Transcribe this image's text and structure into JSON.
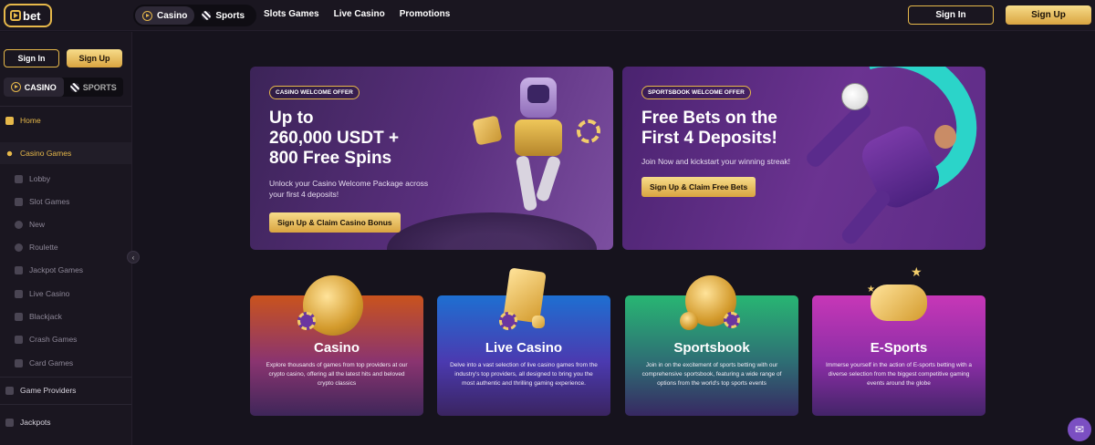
{
  "header": {
    "logo_text": "bet",
    "mode_tabs": [
      {
        "label": "Casino",
        "active": true
      },
      {
        "label": "Sports",
        "active": false
      }
    ],
    "nav": [
      "Slots Games",
      "Live Casino",
      "Promotions"
    ],
    "sign_in_label": "Sign In",
    "sign_up_label": "Sign Up"
  },
  "sidebar": {
    "sign_in_label": "Sign In",
    "sign_up_label": "Sign Up",
    "mode_tabs": [
      {
        "label": "CASINO",
        "active": true
      },
      {
        "label": "SPORTS",
        "active": false
      }
    ],
    "items": [
      {
        "label": "Home",
        "icon": "home-icon"
      },
      {
        "label": "Casino Games",
        "icon": "casino-games-icon"
      },
      {
        "label": "Lobby",
        "icon": "lobby-icon"
      },
      {
        "label": "Slot Games",
        "icon": "slot-icon"
      },
      {
        "label": "New",
        "icon": "new-icon"
      },
      {
        "label": "Roulette",
        "icon": "roulette-icon"
      },
      {
        "label": "Jackpot Games",
        "icon": "jackpot-icon"
      },
      {
        "label": "Live Casino",
        "icon": "crown-icon"
      },
      {
        "label": "Blackjack",
        "icon": "blackjack-icon"
      },
      {
        "label": "Crash Games",
        "icon": "plane-icon"
      },
      {
        "label": "Card Games",
        "icon": "cards-icon"
      },
      {
        "label": "Game Providers",
        "icon": "providers-icon"
      },
      {
        "label": "Jackpots",
        "icon": "jackpots-icon"
      }
    ]
  },
  "banners": [
    {
      "tag": "CASINO WELCOME OFFER",
      "headline_lines": [
        "Up to",
        "260,000 USDT +",
        "800 Free Spins"
      ],
      "subtext_lines": [
        "Unlock your Casino Welcome Package across",
        "your first 4 deposits!"
      ],
      "cta": "Sign Up & Claim Casino Bonus"
    },
    {
      "tag": "SPORTSBOOK WELCOME OFFER",
      "headline_lines": [
        "Free Bets on the",
        "First 4 Deposits!"
      ],
      "subtext_lines": [
        "Join Now and kickstart your winning streak!"
      ],
      "cta": "Sign Up & Claim Free Bets"
    }
  ],
  "categories": [
    {
      "title": "Casino",
      "desc": "Explore thousands of games from top providers at our crypto casino, offering all the latest hits and beloved crypto classics"
    },
    {
      "title": "Live Casino",
      "desc": "Delve into a vast selection of live casino games from the industry's top providers, all designed to bring you the most authentic and thrilling gaming experience."
    },
    {
      "title": "Sportsbook",
      "desc": "Join in on the excitement of sports betting with our comprehensive sportsbook, featuring a wide range of options from the world's top sports events"
    },
    {
      "title": "E-Sports",
      "desc": "Immerse yourself in the action of E-sports betting with a diverse selection from the biggest competitive gaming events around the globe"
    }
  ],
  "colors": {
    "accent_gold": "#e6b84a",
    "background": "#16131d",
    "chat_button": "#7b4fc2"
  }
}
